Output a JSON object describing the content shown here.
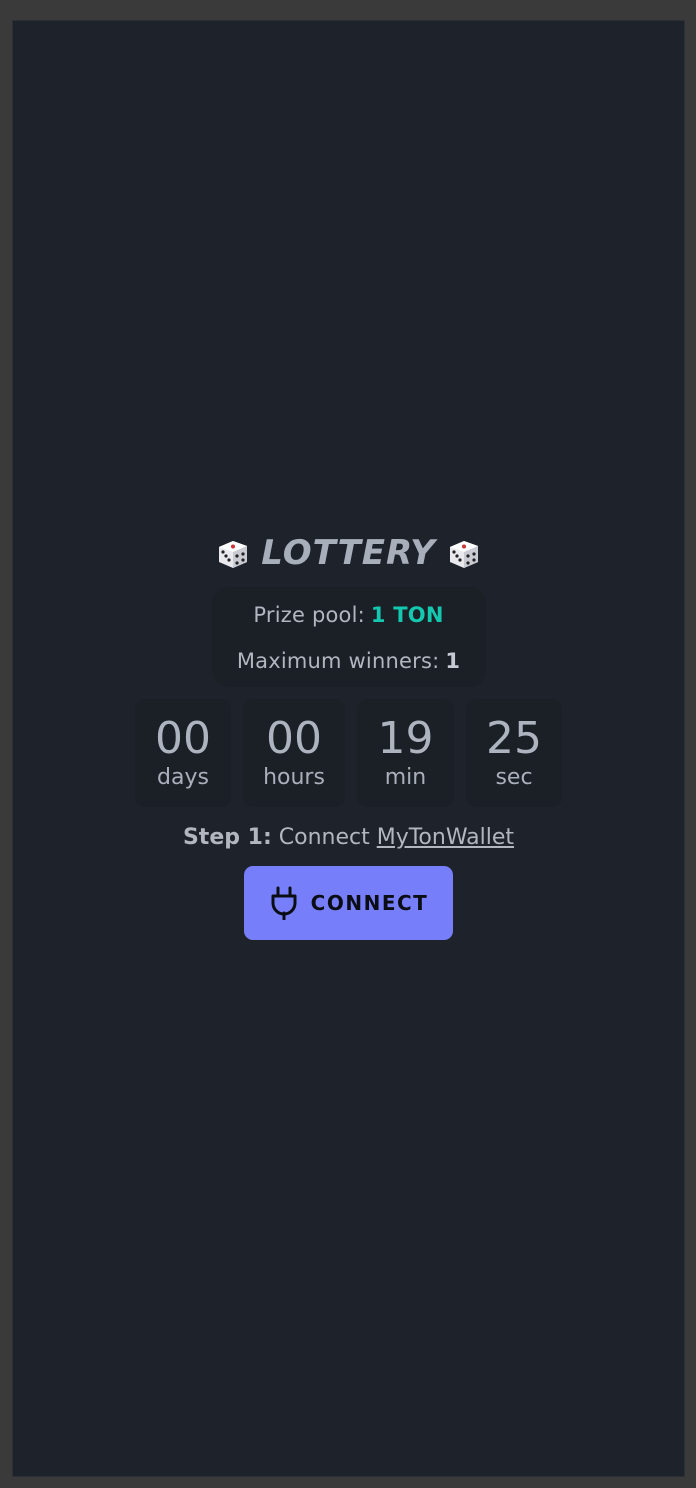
{
  "lottery": {
    "title": "LOTTERY",
    "prize_pool_label": "Prize pool:",
    "prize_pool_value": "1 TON",
    "max_winners_label": "Maximum winners:",
    "max_winners_value": "1"
  },
  "countdown": [
    {
      "value": "00",
      "unit": "days"
    },
    {
      "value": "00",
      "unit": "hours"
    },
    {
      "value": "19",
      "unit": "min"
    },
    {
      "value": "25",
      "unit": "sec"
    }
  ],
  "step": {
    "prefix": "Step 1:",
    "text": "Connect",
    "link": "MyTonWallet"
  },
  "connect_button": {
    "label": "CONNECT",
    "icon": "plug-icon"
  },
  "colors": {
    "background": "#1e232b",
    "card": "#1b1f26",
    "accent_ton": "#14c8b0",
    "button": "#777ef9"
  }
}
